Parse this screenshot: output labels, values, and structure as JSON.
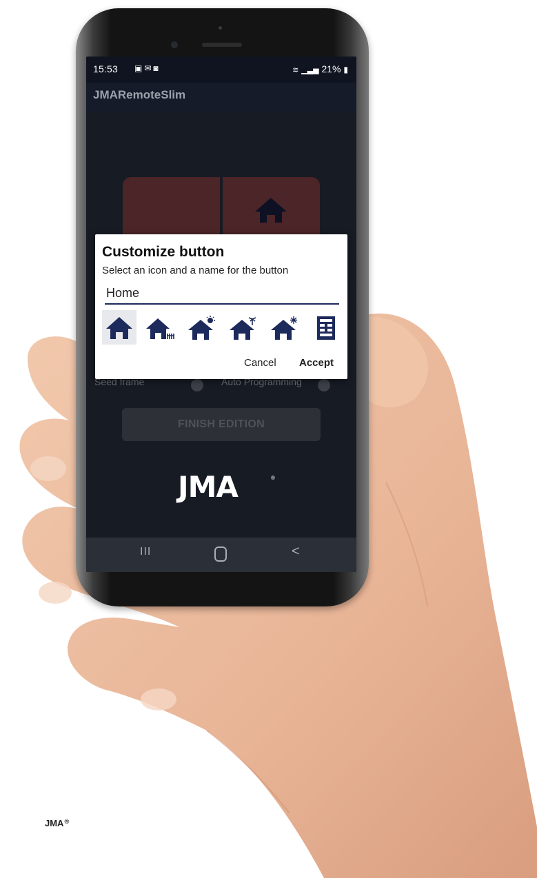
{
  "status_bar": {
    "time": "15:53",
    "notification_icons": [
      "image-icon",
      "mail-icon",
      "app-icon"
    ],
    "signal_icons": [
      "wifi-icon",
      "signal-icon"
    ],
    "battery_percent": "21%",
    "battery_icon": "battery-icon"
  },
  "app": {
    "title": "JMARemoteSlim",
    "remote_buttons": [
      {
        "icon": "none"
      },
      {
        "icon": "home-icon"
      }
    ],
    "seed_frame_label": "Seed frame",
    "auto_programming_label": "Auto Programming",
    "finish_label": "FINISH EDITION",
    "logo_text": "JMA",
    "logo_mark": "®"
  },
  "dialog": {
    "title": "Customize button",
    "subtitle": "Select an icon and a name for the button",
    "name_value": "Home",
    "icons": [
      {
        "name": "home-icon",
        "selected": true
      },
      {
        "name": "home-fence-icon",
        "selected": false
      },
      {
        "name": "home-sun-icon",
        "selected": false
      },
      {
        "name": "home-palm-icon",
        "selected": false
      },
      {
        "name": "home-snow-icon",
        "selected": false
      },
      {
        "name": "building-icon",
        "selected": false
      }
    ],
    "cancel_label": "Cancel",
    "accept_label": "Accept"
  },
  "nav_bar": {
    "recents_label": "III",
    "home_icon": "home-circle-icon",
    "back_label": "<"
  },
  "caption": {
    "text": "JMA",
    "mark": "®"
  },
  "colors": {
    "accent_navy": "#1d2a5c",
    "remote_button": "#4c2528",
    "screen_bg": "#171b24"
  }
}
